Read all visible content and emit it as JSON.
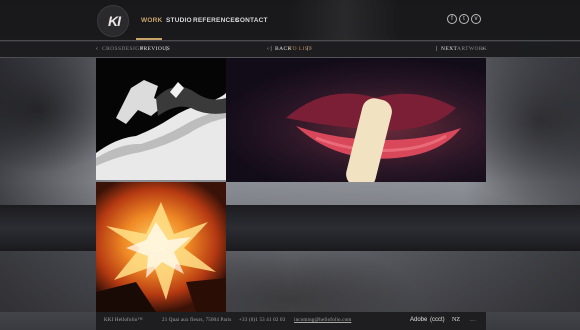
{
  "header": {
    "logo_text": "KI",
    "nav": [
      {
        "label": "Work",
        "active": true
      },
      {
        "label": "Studio",
        "active": false
      },
      {
        "label": "References",
        "active": false
      },
      {
        "label": "Contact",
        "active": false
      }
    ],
    "social": [
      "f",
      "t",
      "v"
    ],
    "social_icons": [
      "facebook-icon",
      "twitter-icon",
      "vimeo-icon"
    ]
  },
  "subnav": {
    "left_label": "Crossdesign",
    "previous_label": "Previous",
    "back_label": "Back",
    "back_to_label": "to list",
    "next_label": "Next",
    "next_project_label": "Artwork"
  },
  "footer": {
    "company": "KKI Hellofolio™",
    "address": "21 Quai aux fleurs, 75004 Paris",
    "phone": "+33 (0)1 53 41 02 03",
    "email": "incoming@hellofolio.com",
    "clients": [
      "Adobe",
      "(ccct)",
      "NZ",
      "....."
    ]
  },
  "colors": {
    "accent": "#c9a46a",
    "header_bg": "#161618",
    "footer_bg": "#1e1e20"
  }
}
